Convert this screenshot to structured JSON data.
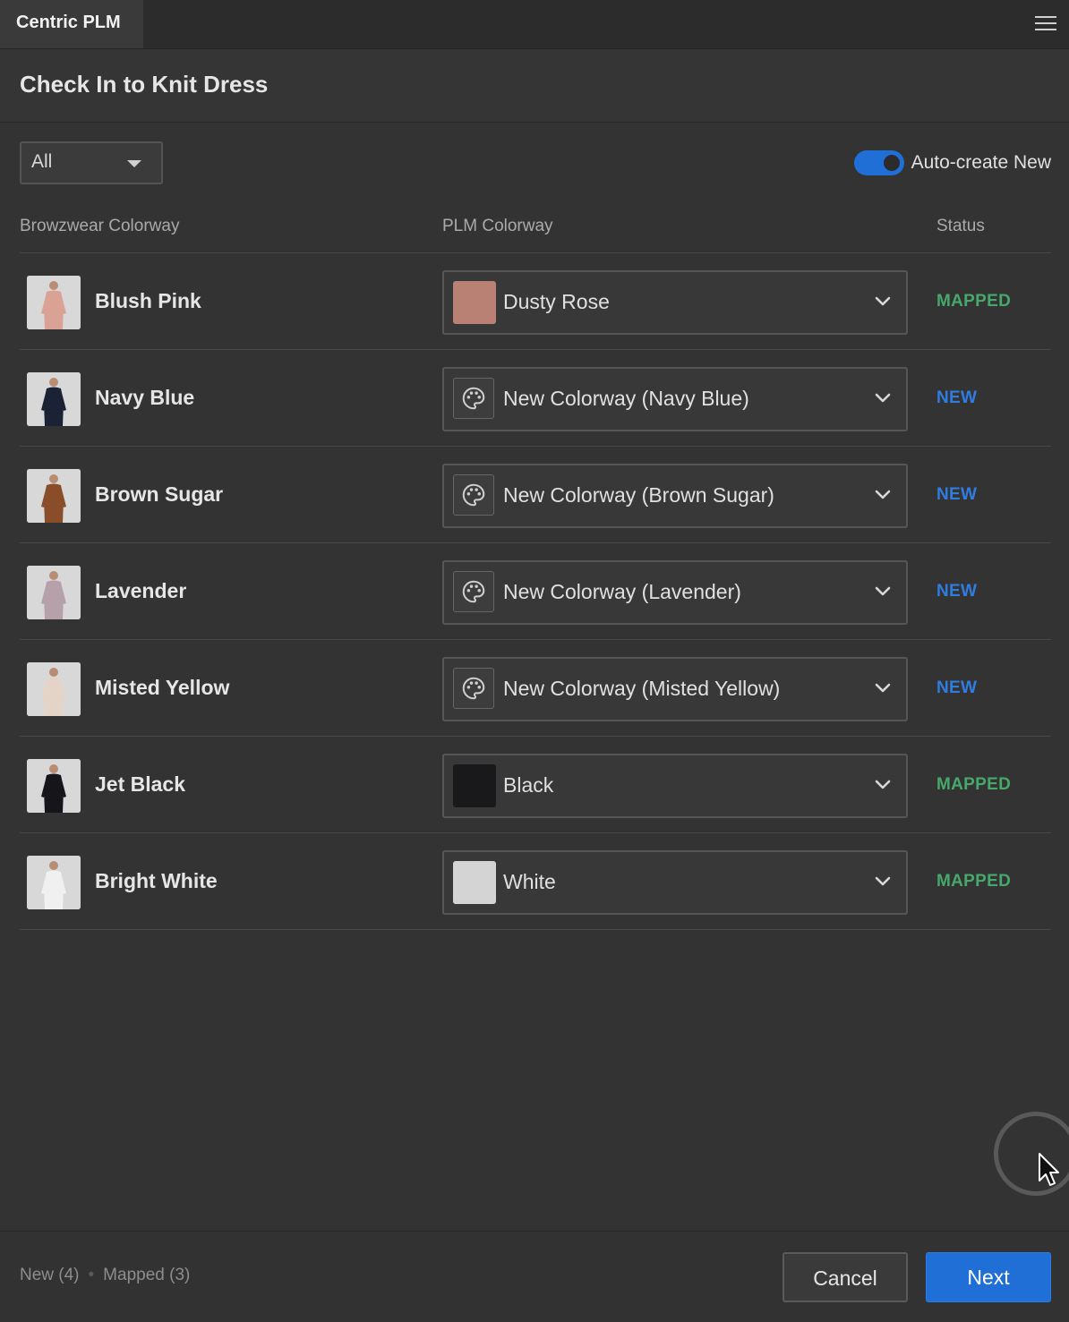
{
  "app": {
    "title": "Centric PLM",
    "menu_icon": "hamburger-menu-icon"
  },
  "header": {
    "title": "Check In to Knit Dress"
  },
  "filter": {
    "selected": "All"
  },
  "auto_create": {
    "label": "Auto-create New",
    "enabled": true
  },
  "columns": {
    "browzwear": "Browzwear Colorway",
    "plm": "PLM Colorway",
    "status": "Status"
  },
  "colors": {
    "accent": "#1f6fd6",
    "mapped": "#47a86b",
    "new": "#2f7de1"
  },
  "rows": [
    {
      "name": "Blush Pink",
      "garment_color": "#d9a295",
      "plm_value": "Dusty Rose",
      "plm_kind": "swatch",
      "swatch_color": "#b98173",
      "status": "MAPPED"
    },
    {
      "name": "Navy Blue",
      "garment_color": "#1c2236",
      "plm_value": "New Colorway (Navy Blue)",
      "plm_kind": "palette-icon",
      "swatch_color": "",
      "status": "NEW"
    },
    {
      "name": "Brown Sugar",
      "garment_color": "#8a4d2a",
      "plm_value": "New Colorway (Brown Sugar)",
      "plm_kind": "palette-icon",
      "swatch_color": "",
      "status": "NEW"
    },
    {
      "name": "Lavender",
      "garment_color": "#b6a1ab",
      "plm_value": "New Colorway (Lavender)",
      "plm_kind": "palette-icon",
      "swatch_color": "",
      "status": "NEW"
    },
    {
      "name": "Misted Yellow",
      "garment_color": "#e4d4c8",
      "plm_value": "New Colorway (Misted Yellow)",
      "plm_kind": "palette-icon",
      "swatch_color": "",
      "status": "NEW"
    },
    {
      "name": "Jet Black",
      "garment_color": "#16161a",
      "plm_value": "Black",
      "plm_kind": "swatch",
      "swatch_color": "#19191c",
      "status": "MAPPED"
    },
    {
      "name": "Bright White",
      "garment_color": "#f0f0f0",
      "plm_value": "White",
      "plm_kind": "swatch",
      "swatch_color": "#d4d4d4",
      "status": "MAPPED"
    }
  ],
  "footer": {
    "new_summary": "New (4)",
    "mapped_summary": "Mapped (3)",
    "separator": "•",
    "cancel_label": "Cancel",
    "next_label": "Next"
  }
}
